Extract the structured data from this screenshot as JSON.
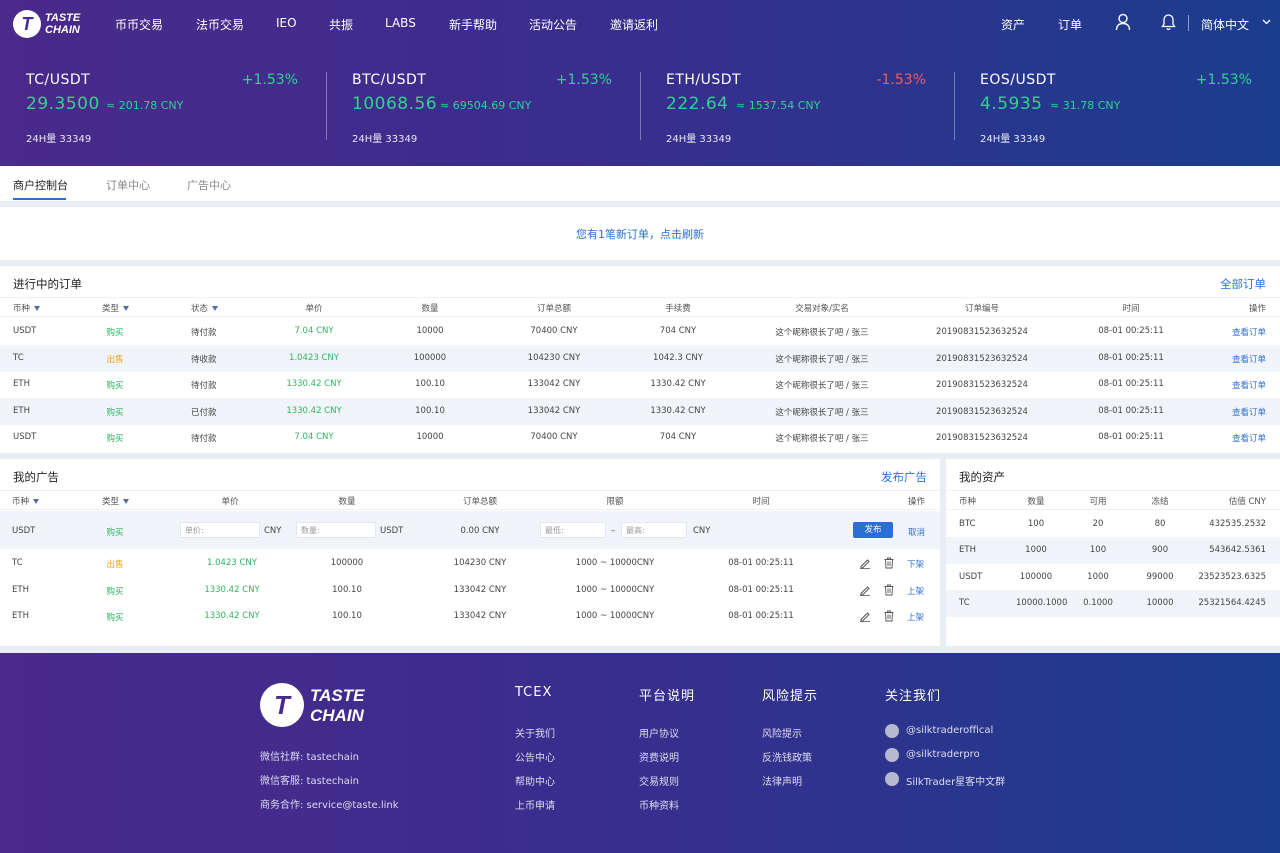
{
  "brand": {
    "line1": "TASTE",
    "line2": "CHAIN",
    "mark": "T"
  },
  "nav": {
    "items": [
      "币币交易",
      "法币交易",
      "IEO",
      "共振",
      "LABS",
      "新手帮助",
      "活动公告",
      "邀请返利"
    ],
    "assets": "资产",
    "orders": "订单",
    "language": "简体中文"
  },
  "tickers": [
    {
      "pair": "TC/USDT",
      "change": "+1.53%",
      "dir": "up",
      "price": "29.3500",
      "cny": "≈ 201.78 CNY",
      "vol": "24H量  33349"
    },
    {
      "pair": "BTC/USDT",
      "change": "+1.53%",
      "dir": "up",
      "price": "10068.56",
      "cny": "≈ 69504.69 CNY",
      "vol": "24H量  33349"
    },
    {
      "pair": "ETH/USDT",
      "change": "-1.53%",
      "dir": "down",
      "price": "222.64",
      "cny": "≈ 1537.54 CNY",
      "vol": "24H量  33349"
    },
    {
      "pair": "EOS/USDT",
      "change": "+1.53%",
      "dir": "up",
      "price": "4.5935",
      "cny": "≈ 31.78 CNY",
      "vol": "24H量  33349"
    }
  ],
  "tabs": [
    "商户控制台",
    "订单中心",
    "广告中心"
  ],
  "notice": "您有1笔新订单，点击刷新",
  "orders": {
    "title": "进行中的订单",
    "all_link": "全部订单",
    "headers": [
      "币种",
      "类型",
      "状态",
      "单价",
      "数量",
      "订单总额",
      "手续费",
      "交易对象/实名",
      "订单编号",
      "时间",
      "操作"
    ],
    "rows": [
      [
        "USDT",
        "购买",
        "待付款",
        "7.04 CNY",
        "10000",
        "70400 CNY",
        "704 CNY",
        "这个昵称很长了吧 / 张三",
        "20190831523632524",
        "08-01 00:25:11",
        "查看订单"
      ],
      [
        "TC",
        "出售",
        "待收款",
        "1.0423 CNY",
        "100000",
        "104230 CNY",
        "1042.3 CNY",
        "这个昵称很长了吧 / 张三",
        "20190831523632524",
        "08-01 00:25:11",
        "查看订单"
      ],
      [
        "ETH",
        "购买",
        "待付款",
        "1330.42 CNY",
        "100.10",
        "133042 CNY",
        "1330.42 CNY",
        "这个昵称很长了吧 / 张三",
        "20190831523632524",
        "08-01 00:25:11",
        "查看订单"
      ],
      [
        "ETH",
        "购买",
        "已付款",
        "1330.42 CNY",
        "100.10",
        "133042 CNY",
        "1330.42 CNY",
        "这个昵称很长了吧 / 张三",
        "20190831523632524",
        "08-01 00:25:11",
        "查看订单"
      ],
      [
        "USDT",
        "购买",
        "待付款",
        "7.04 CNY",
        "10000",
        "70400 CNY",
        "704 CNY",
        "这个昵称很长了吧 / 张三",
        "20190831523632524",
        "08-01 00:25:11",
        "查看订单"
      ]
    ]
  },
  "ads": {
    "title": "我的广告",
    "publish_link": "发布广告",
    "headers": [
      "币种",
      "类型",
      "单价",
      "数量",
      "订单总额",
      "限额",
      "时间",
      "操作"
    ],
    "new_row": {
      "coin": "USDT",
      "type": "购买",
      "price_placeholder": "单价:",
      "price_unit": "CNY",
      "qty_placeholder": "数量:",
      "qty_unit": "USDT",
      "total": "0.00 CNY",
      "min_placeholder": "最低:",
      "dash": "–",
      "max_placeholder": "最高:",
      "limit_unit": "CNY",
      "publish": "发布",
      "cancel": "取消"
    },
    "rows": [
      [
        "TC",
        "出售",
        "1.0423 CNY",
        "100000",
        "104230 CNY",
        "1000 ~ 10000CNY",
        "08-01 00:25:11",
        "下架"
      ],
      [
        "ETH",
        "购买",
        "1330.42 CNY",
        "100.10",
        "133042 CNY",
        "1000 ~ 10000CNY",
        "08-01 00:25:11",
        "上架"
      ],
      [
        "ETH",
        "购买",
        "1330.42 CNY",
        "100.10",
        "133042 CNY",
        "1000 ~ 10000CNY",
        "08-01 00:25:11",
        "上架"
      ]
    ]
  },
  "assets": {
    "title": "我的资产",
    "headers": [
      "币种",
      "数量",
      "可用",
      "冻结",
      "估值 CNY"
    ],
    "rows": [
      [
        "BTC",
        "100",
        "20",
        "80",
        "432535.2532"
      ],
      [
        "ETH",
        "1000",
        "100",
        "900",
        "543642.5361"
      ],
      [
        "USDT",
        "100000",
        "1000",
        "99000",
        "23523523.6325"
      ],
      [
        "TC",
        "10000.1000",
        "0.1000",
        "10000",
        "25321564.4245"
      ]
    ]
  },
  "footer": {
    "info": [
      "微信社群: tastechain",
      "微信客服: tastechain",
      "商务合作: service@taste.link"
    ],
    "columns": [
      {
        "title": "TCEX",
        "links": [
          "关于我们",
          "公告中心",
          "帮助中心",
          "上币申请"
        ]
      },
      {
        "title": "平台说明",
        "links": [
          "用户协议",
          "资费说明",
          "交易规则",
          "币种资料"
        ]
      },
      {
        "title": "风险提示",
        "links": [
          "风险提示",
          "反洗钱政策",
          "法律声明"
        ]
      },
      {
        "title": "关注我们",
        "links": [
          "@silktraderoffical",
          "@silktraderpro",
          "SilkTrader星客中文群"
        ]
      }
    ]
  },
  "colors": {
    "up": "#2fd38e",
    "down": "#f05a5a",
    "accent": "#2b6fd6",
    "buy": "#2db560",
    "sell": "#f0a020"
  }
}
